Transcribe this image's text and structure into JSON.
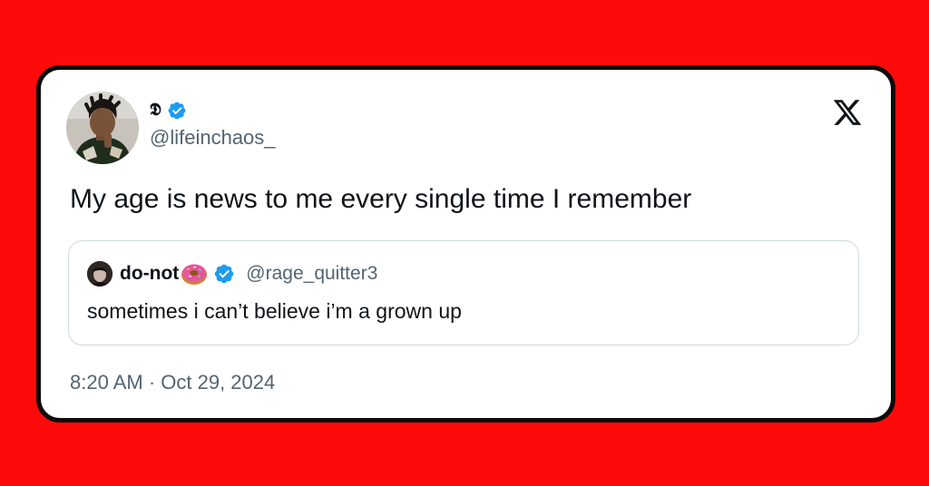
{
  "colors": {
    "background": "#fe0a0a",
    "card": "#ffffff",
    "card_border": "#0c0c0c",
    "verified_badge": "#1d9bf0",
    "text_primary": "#0f1419",
    "text_secondary": "#536471",
    "quote_border": "#cfd9de"
  },
  "post": {
    "author": {
      "display_name": "𝕯",
      "handle": "@lifeinchaos_",
      "verified": true,
      "avatar_icon": "user-photo-avatar"
    },
    "text": "My age is news to me every single time I remember",
    "timestamp": "8:20 AM · Oct 29, 2024",
    "platform_icon": "x-logo-icon"
  },
  "quoted_post": {
    "author": {
      "display_name": "do-not",
      "emoji_icon": "donut-icon",
      "handle": "@rage_quitter3",
      "verified": true,
      "avatar_icon": "user-photo-avatar"
    },
    "text": "sometimes i can’t believe i’m a grown up"
  }
}
